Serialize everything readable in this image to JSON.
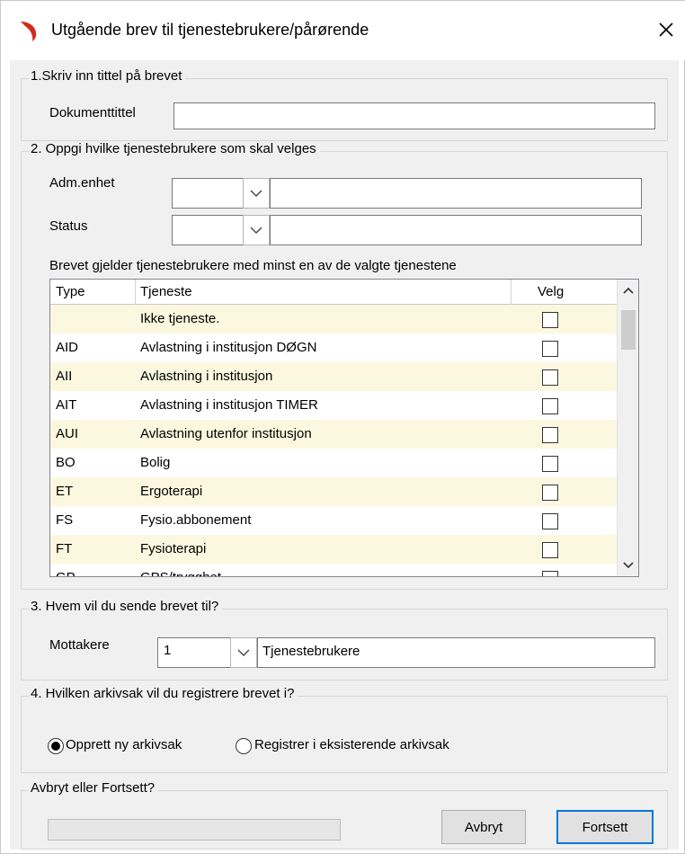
{
  "window": {
    "title": "Utgående brev til tjenestebrukere/pårørende",
    "close_icon": "close-icon",
    "logo_icon": "app-logo-icon",
    "logo_color": "#d42a1e"
  },
  "section1": {
    "legend": "1.Skriv inn tittel på brevet",
    "doc_title_label": "Dokumenttittel",
    "doc_title_value": ""
  },
  "section2": {
    "legend": "2. Oppgi hvilke tjenestebrukere som skal velges",
    "adm_label": "Adm.enhet",
    "adm_code": "",
    "adm_text": "",
    "status_label": "Status",
    "status_code": "",
    "status_text": "",
    "note": "Brevet gjelder tjenestebrukere med minst en av de valgte tjenestene",
    "grid": {
      "columns": {
        "type": "Type",
        "service": "Tjeneste",
        "select": "Velg"
      },
      "rows": [
        {
          "type": "",
          "service": "Ikke tjeneste.",
          "checked": false
        },
        {
          "type": "AID",
          "service": "Avlastning i institusjon DØGN",
          "checked": false
        },
        {
          "type": "AII",
          "service": "Avlastning i institusjon",
          "checked": false
        },
        {
          "type": "AIT",
          "service": "Avlastning i institusjon TIMER",
          "checked": false
        },
        {
          "type": "AUI",
          "service": "Avlastning utenfor institusjon",
          "checked": false
        },
        {
          "type": "BO",
          "service": "Bolig",
          "checked": false
        },
        {
          "type": "ET",
          "service": "Ergoterapi",
          "checked": false
        },
        {
          "type": "FS",
          "service": "Fysio.abbonement",
          "checked": false
        },
        {
          "type": "FT",
          "service": "Fysioterapi",
          "checked": false
        },
        {
          "type": "GP",
          "service": "GPS/trygghet",
          "checked": false
        }
      ],
      "row_stripe_color": "#fcf8df"
    }
  },
  "section3": {
    "legend": "3. Hvem vil du sende brevet til?",
    "recipients_label": "Mottakere",
    "recipients_code": "1",
    "recipients_text": "Tjenestebrukere"
  },
  "section4": {
    "legend": "4. Hvilken arkivsak vil du registrere brevet i?",
    "option_new": "Opprett ny arkivsak",
    "option_existing": "Registrer i eksisterende arkivsak",
    "selected": "new"
  },
  "section5": {
    "legend": "Avbryt eller Fortsett?",
    "progress": 0,
    "cancel_label": "Avbryt",
    "continue_label": "Fortsett"
  }
}
